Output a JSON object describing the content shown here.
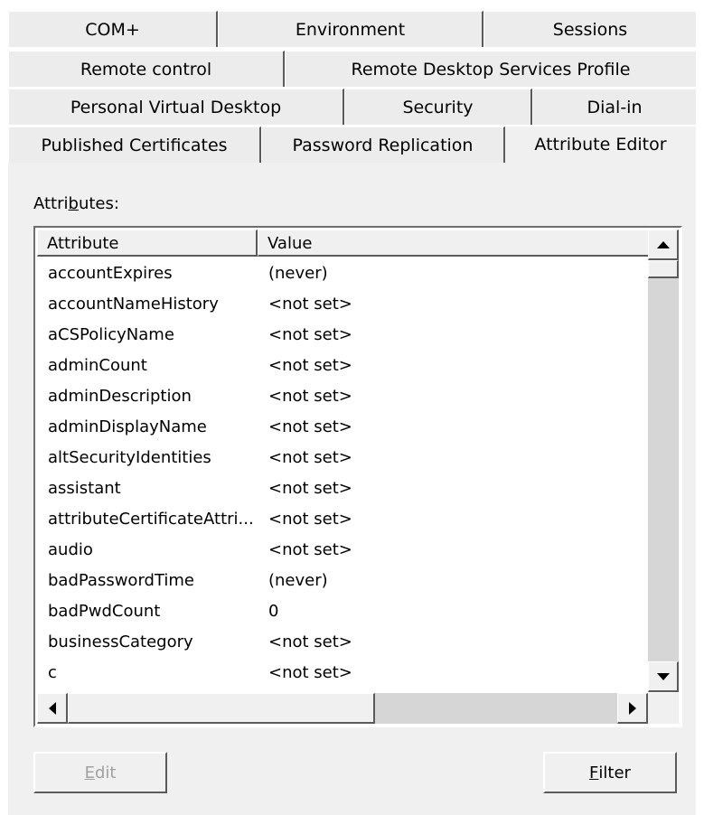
{
  "tabs": {
    "row1": [
      "COM+",
      "Environment",
      "Sessions"
    ],
    "row2": [
      "Remote control",
      "Remote Desktop Services Profile"
    ],
    "row3": [
      "Personal Virtual Desktop",
      "Security",
      "Dial-in"
    ],
    "row4": [
      "Published Certificates",
      "Password Replication",
      "Attribute Editor"
    ],
    "active": "Attribute Editor"
  },
  "attributes_label": {
    "pre": "Attri",
    "mnemonic": "b",
    "post": "utes:"
  },
  "table": {
    "columns": [
      "Attribute",
      "Value"
    ],
    "rows": [
      {
        "attribute": "accountExpires",
        "value": "(never)"
      },
      {
        "attribute": "accountNameHistory",
        "value": "<not set>"
      },
      {
        "attribute": "aCSPolicyName",
        "value": "<not set>"
      },
      {
        "attribute": "adminCount",
        "value": "<not set>"
      },
      {
        "attribute": "adminDescription",
        "value": "<not set>"
      },
      {
        "attribute": "adminDisplayName",
        "value": "<not set>"
      },
      {
        "attribute": "altSecurityIdentities",
        "value": "<not set>"
      },
      {
        "attribute": "assistant",
        "value": "<not set>"
      },
      {
        "attribute": "attributeCertificateAttri...",
        "value": "<not set>"
      },
      {
        "attribute": "audio",
        "value": "<not set>"
      },
      {
        "attribute": "badPasswordTime",
        "value": "(never)"
      },
      {
        "attribute": "badPwdCount",
        "value": "0"
      },
      {
        "attribute": "businessCategory",
        "value": "<not set>"
      },
      {
        "attribute": "c",
        "value": "<not set>"
      },
      {
        "attribute": "",
        "value": ""
      }
    ]
  },
  "buttons": {
    "edit": {
      "mnemonic": "E",
      "rest": "dit"
    },
    "filter": {
      "mnemonic": "F",
      "rest": "ilter"
    }
  },
  "icons": {
    "scroll_up": "triangle-up-icon",
    "scroll_down": "triangle-down-icon",
    "scroll_left": "triangle-left-icon",
    "scroll_right": "triangle-right-icon"
  },
  "colors": {
    "dialog_bg": "#f0f0f0",
    "tab_bg": "#ececec",
    "list_bg": "#ffffff",
    "disabled_text": "#a0a0a0"
  }
}
